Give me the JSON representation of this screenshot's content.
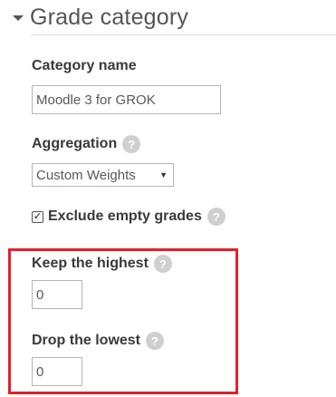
{
  "section": {
    "title": "Grade category"
  },
  "category_name": {
    "label": "Category name",
    "value": "Moodle 3 for GROK"
  },
  "aggregation": {
    "label": "Aggregation",
    "selected": "Custom Weights"
  },
  "exclude_empty": {
    "label": "Exclude empty grades",
    "checked": true
  },
  "keep_highest": {
    "label": "Keep the highest",
    "value": "0"
  },
  "drop_lowest": {
    "label": "Drop the lowest",
    "value": "0"
  },
  "icons": {
    "help": "?",
    "check": "✓",
    "dropdown": "▼"
  },
  "colors": {
    "highlight": "#e0212b",
    "help_icon_bg": "#cfcfcf"
  }
}
